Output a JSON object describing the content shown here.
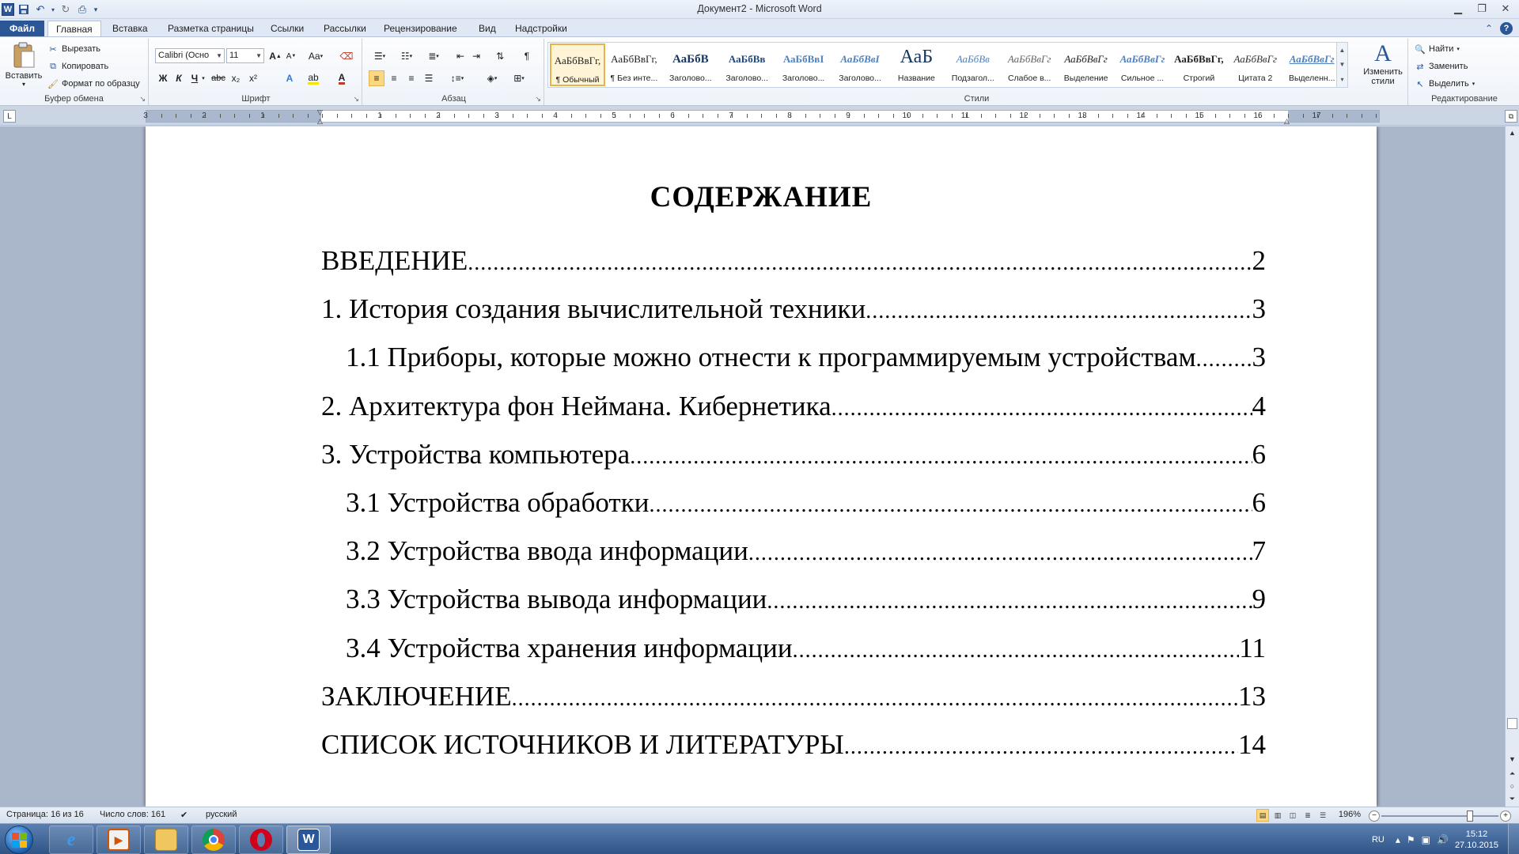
{
  "window": {
    "title": "Документ2 - Microsoft Word"
  },
  "tabs": {
    "file": "Файл",
    "home": "Главная",
    "insert": "Вставка",
    "layout": "Разметка страницы",
    "references": "Ссылки",
    "mailings": "Рассылки",
    "review": "Рецензирование",
    "view": "Вид",
    "addins": "Надстройки"
  },
  "clipboard": {
    "paste": "Вставить",
    "cut": "Вырезать",
    "copy": "Копировать",
    "format_painter": "Формат по образцу",
    "label": "Буфер обмена"
  },
  "font": {
    "family": "Calibri (Осно",
    "size": "11",
    "label": "Шрифт",
    "bold": "Ж",
    "italic": "К",
    "underline": "Ч",
    "strike": "abc",
    "sub": "x₂",
    "sup": "x²",
    "change_case": "Aa",
    "grow": "A",
    "shrink": "A",
    "color": "A"
  },
  "paragraph": {
    "label": "Абзац",
    "pilcrow": "¶"
  },
  "styles": {
    "label": "Стили",
    "change": "Изменить стили",
    "items": [
      {
        "preview": "АаБбВвГг,",
        "name": "¶ Обычный"
      },
      {
        "preview": "АаБбВвГг,",
        "name": "¶ Без инте..."
      },
      {
        "preview": "АаБбВ",
        "name": "Заголово..."
      },
      {
        "preview": "АаБбВв",
        "name": "Заголово..."
      },
      {
        "preview": "АаБбВвI",
        "name": "Заголово..."
      },
      {
        "preview": "АаБбВвI",
        "name": "Заголово..."
      },
      {
        "preview": "АаБ",
        "name": "Название"
      },
      {
        "preview": "АаБбВв",
        "name": "Подзагол..."
      },
      {
        "preview": "АаБбВвГг",
        "name": "Слабое в..."
      },
      {
        "preview": "АаБбВвГг",
        "name": "Выделение"
      },
      {
        "preview": "АаБбВвГг",
        "name": "Сильное ..."
      },
      {
        "preview": "АаБбВвГг,",
        "name": "Строгий"
      },
      {
        "preview": "АаБбВвГг",
        "name": "Цитата 2"
      },
      {
        "preview": "АаБбВвГг",
        "name": "Выделенн..."
      }
    ]
  },
  "editing": {
    "label": "Редактирование",
    "find": "Найти",
    "replace": "Заменить",
    "select": "Выделить"
  },
  "ruler": {
    "left_numbers": [
      "3",
      "2",
      "1"
    ],
    "numbers": [
      "1",
      "2",
      "3",
      "4",
      "5",
      "6",
      "7",
      "8",
      "9",
      "10",
      "11",
      "12",
      "13",
      "14",
      "15",
      "16",
      "17"
    ]
  },
  "document": {
    "title": "СОДЕРЖАНИЕ",
    "toc": [
      {
        "text": "ВВЕДЕНИЕ ",
        "page": "2",
        "level": 1
      },
      {
        "text": "1. История создания вычислительной техники",
        "page": "3",
        "level": 1
      },
      {
        "text": "1.1 Приборы, которые можно отнести к программируемым устройствам",
        "page": "3",
        "level": 2
      },
      {
        "text": "2. Архитектура фон Неймана. Кибернетика",
        "page": "4",
        "level": 1
      },
      {
        "text": "3. Устройства компьютера",
        "page": "6",
        "level": 1
      },
      {
        "text": "3.1 Устройства обработки",
        "page": "6",
        "level": 2
      },
      {
        "text": "3.2 Устройства ввода информации ",
        "page": "7",
        "level": 2
      },
      {
        "text": "3.3 Устройства вывода информации ",
        "page": "9",
        "level": 2
      },
      {
        "text": "3.4 Устройства хранения информации",
        "page": "11",
        "level": 2
      },
      {
        "text": "ЗАКЛЮЧЕНИЕ",
        "page": "13",
        "level": 1
      },
      {
        "text": "СПИСОК ИСТОЧНИКОВ И ЛИТЕРАТУРЫ ",
        "page": "14",
        "level": 1
      }
    ]
  },
  "status": {
    "page": "Страница: 16 из 16",
    "words": "Число слов: 161",
    "language": "русский",
    "zoom": "196%"
  },
  "taskbar": {
    "lang": "RU",
    "time": "15:12",
    "date": "27.10.2015"
  },
  "colors": {
    "accent": "#2b5797",
    "highlight": "#fbd880"
  }
}
